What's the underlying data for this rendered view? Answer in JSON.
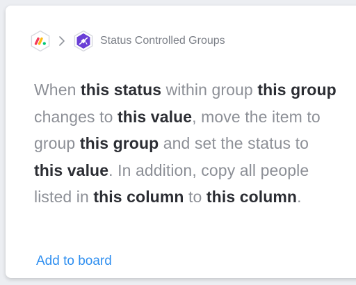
{
  "header": {
    "app_icon": "monday-logo-icon",
    "separator_icon": "chevron-right-icon",
    "integration_icon": "satellite-icon",
    "title": "Status Controlled Groups"
  },
  "recipe": {
    "segments": [
      {
        "text": "When ",
        "bold": false
      },
      {
        "text": "this status",
        "bold": true
      },
      {
        "text": " within group ",
        "bold": false
      },
      {
        "text": "this group",
        "bold": true
      },
      {
        "text": " changes to ",
        "bold": false
      },
      {
        "text": "this value",
        "bold": true
      },
      {
        "text": ", move the item to group ",
        "bold": false
      },
      {
        "text": "this group",
        "bold": true
      },
      {
        "text": " and set the status to ",
        "bold": false
      },
      {
        "text": "this value",
        "bold": true
      },
      {
        "text": ". In addition, copy all people listed in ",
        "bold": false
      },
      {
        "text": "this column",
        "bold": true
      },
      {
        "text": " to ",
        "bold": false
      },
      {
        "text": "this column",
        "bold": true
      },
      {
        "text": ".",
        "bold": false
      }
    ]
  },
  "actions": {
    "add_label": "Add to board"
  },
  "colors": {
    "link": "#2f8ff0",
    "integration_bg": "#6a3fd6",
    "monday_red": "#f43c5a",
    "monday_yellow": "#fdbb15",
    "monday_green": "#00c875"
  }
}
